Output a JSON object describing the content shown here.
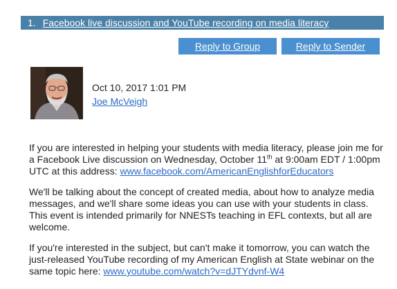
{
  "topic": {
    "number": "1.",
    "title": "Facebook live discussion and YouTube recording on media literacy"
  },
  "actions": {
    "reply_group": "Reply to Group",
    "reply_sender": "Reply to Sender"
  },
  "post": {
    "date": "Oct 10, 2017 1:01 PM",
    "author": "Joe McVeigh"
  },
  "message": {
    "p1_a": "If you are interested in helping your students with media literacy, please join me for a Facebook Live discussion on Wednesday, October 11",
    "p1_sup": "th",
    "p1_b": " at 9:00am EDT / 1:00pm UTC at this address: ",
    "p1_link": "www.facebook.com/AmericanEnglishforEducators",
    "p2": "We'll be talking about the concept of created media, about how to analyze media messages, and we'll share some ideas you can use with your students in class. This event is intended primarily for NNESTs teaching in EFL contexts, but all are welcome.",
    "p3_a": "If you're interested in the subject, but can't make it tomorrow, you can watch the just-released YouTube recording of my  American English at State webinar on the same topic here: ",
    "p3_link": "www.youtube.com/watch?v=dJTYdvnf-W4"
  },
  "colors": {
    "topic_bar": "#4a81a8",
    "button": "#4a8fd0",
    "link": "#2a6ac5"
  }
}
